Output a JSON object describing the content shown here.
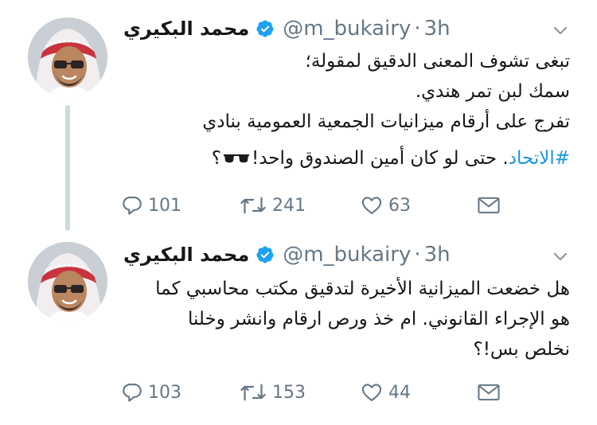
{
  "tweets": [
    {
      "author": {
        "name": "محمد البكيري",
        "handle": "@m_bukairy",
        "time": "3h",
        "verified": true
      },
      "text_lines": [
        "تبغى تشوف المعنى الدقيق لمقولة؛",
        "سمك لبن تمر هندي.",
        "تفرج على أرقام ميزانيات الجمعية العمومية بنادي"
      ],
      "last_line": {
        "hashtag": "#الاتحاد",
        "text": ". حتى لو كان أمين الصندوق واحد!",
        "emoji": "sunglasses",
        "end": "؟"
      },
      "actions": {
        "replies": "101",
        "retweets": "241",
        "likes": "63"
      }
    },
    {
      "author": {
        "name": "محمد البكيري",
        "handle": "@m_bukairy",
        "time": "3h",
        "verified": true
      },
      "text_lines": [
        "هل خضعت الميزانية الأخيرة لتدقيق مكتب محاسبي كما",
        "هو الإجراء القانوني. ام خذ ورص ارقام وانشر وخلنا",
        "نخلص بس!؟"
      ],
      "actions": {
        "replies": "103",
        "retweets": "153",
        "likes": "44"
      }
    }
  ],
  "colors": {
    "text": "#14171a",
    "secondary": "#657786",
    "link": "#1b95e0",
    "verified": "#1da1f2",
    "thread_line": "#cfd9de"
  }
}
